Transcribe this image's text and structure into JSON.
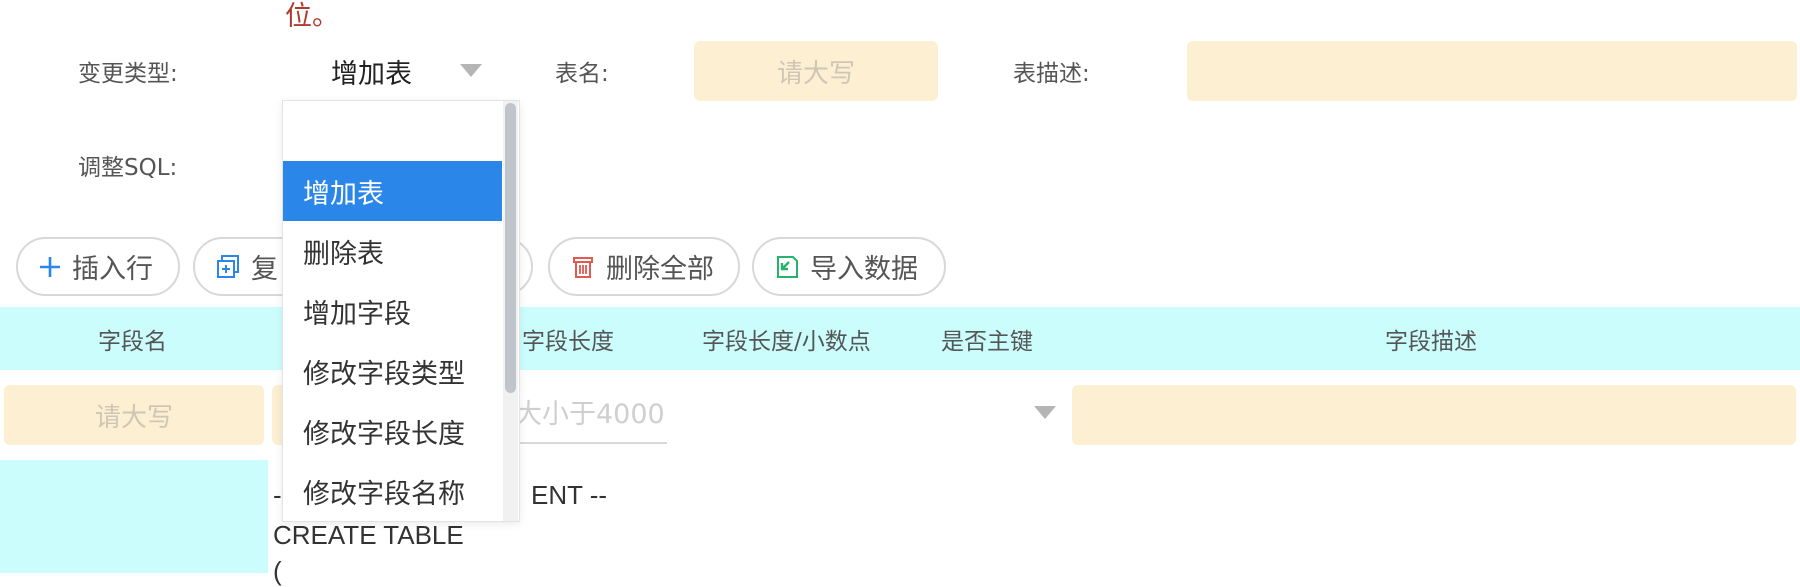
{
  "notice": "位。",
  "form": {
    "change_type_label": "变更类型:",
    "change_type_value": "增加表",
    "table_name_label": "表名:",
    "table_name_placeholder": "请大写",
    "table_desc_label": "表描述:",
    "adjust_sql_label": "调整SQL:"
  },
  "toolbar": {
    "insert_row": "插入行",
    "copy": "复",
    "delete_all": "删除全部",
    "import_data": "导入数据"
  },
  "table": {
    "columns": [
      "字段名",
      "字段长度",
      "字段长度/小数点",
      "是否主键",
      "字段描述"
    ],
    "row_field_name_placeholder": "请大写",
    "row_length_placeholder": "大小于4000"
  },
  "sql_lines": [
    "-",
    "ENT --",
    "CREATE TABLE",
    "("
  ],
  "dropdown": {
    "options": [
      "",
      "增加表",
      "删除表",
      "增加字段",
      "修改字段类型",
      "修改字段长度",
      "修改字段名称"
    ],
    "selected": "增加表"
  },
  "colors": {
    "accent": "#2a86e8",
    "header_bg": "#ccfdfd",
    "input_bg": "#fdefd2",
    "notice": "#b03a2e"
  },
  "icons": {
    "insert_row": "plus-icon",
    "copy": "copy-icon",
    "delete_all": "trash-icon",
    "import_data": "import-icon",
    "select": "chevron-down-icon"
  }
}
